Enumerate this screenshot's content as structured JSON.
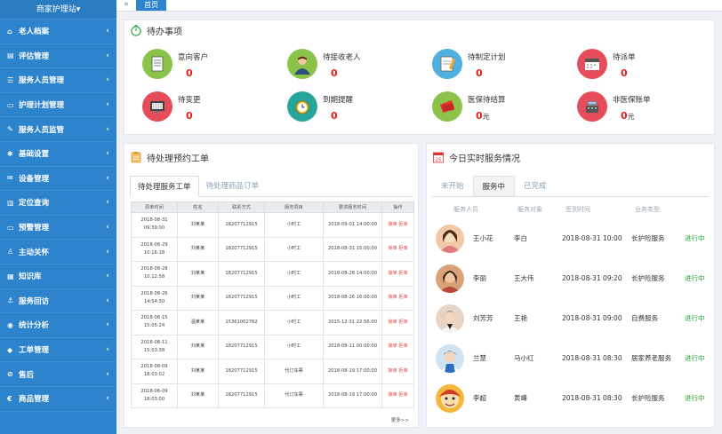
{
  "sidebar": {
    "brand": "商家护理站",
    "items": [
      {
        "icon": "home-icon",
        "glyph": "⌂",
        "label": "老人档案"
      },
      {
        "icon": "clipboard-icon",
        "glyph": "▤",
        "label": "评估管理"
      },
      {
        "icon": "list-icon",
        "glyph": "☰",
        "label": "服务人员管理"
      },
      {
        "icon": "folder-icon",
        "glyph": "▭",
        "label": "护理计划管理"
      },
      {
        "icon": "pencil-icon",
        "glyph": "✎",
        "label": "服务人员监管"
      },
      {
        "icon": "gear-icon",
        "glyph": "✱",
        "label": "基础设置"
      },
      {
        "icon": "envelope-icon",
        "glyph": "✉",
        "label": "设备管理"
      },
      {
        "icon": "building-icon",
        "glyph": "▥",
        "label": "定位查询"
      },
      {
        "icon": "monitor-icon",
        "glyph": "▭",
        "label": "预警管理"
      },
      {
        "icon": "user-icon",
        "glyph": "♙",
        "label": "主动关怀"
      },
      {
        "icon": "grid-icon",
        "glyph": "▦",
        "label": "知识库"
      },
      {
        "icon": "anchor-icon",
        "glyph": "⚓",
        "label": "服务回访"
      },
      {
        "icon": "chart-icon",
        "glyph": "◉",
        "label": "统计分析"
      },
      {
        "icon": "tag-icon",
        "glyph": "◆",
        "label": "工单管理"
      },
      {
        "icon": "cancel-icon",
        "glyph": "⊘",
        "label": "售后"
      },
      {
        "icon": "euro-icon",
        "glyph": "€",
        "label": "商品管理"
      }
    ]
  },
  "topbar": {
    "home_tab": "首页"
  },
  "todo": {
    "title": "待办事项",
    "items": [
      {
        "label": "意向客户",
        "value": "0",
        "unit": "",
        "color": "#8bc34a",
        "icon": "document-icon"
      },
      {
        "label": "待接收老人",
        "value": "0",
        "unit": "",
        "color": "#8bc34a",
        "icon": "person-icon"
      },
      {
        "label": "待制定计划",
        "value": "0",
        "unit": "",
        "color": "#4fb0e0",
        "icon": "notepad-icon"
      },
      {
        "label": "待派单",
        "value": "0",
        "unit": "",
        "color": "#e54d5a",
        "icon": "calendar-icon"
      },
      {
        "label": "待变更",
        "value": "0",
        "unit": "",
        "color": "#e54d5a",
        "icon": "monitor-icon"
      },
      {
        "label": "到期提醒",
        "value": "0",
        "unit": "",
        "color": "#26a69a",
        "icon": "clock-icon"
      },
      {
        "label": "医保待结算",
        "value": "0",
        "unit": "元",
        "color": "#8bc34a",
        "icon": "money-icon"
      },
      {
        "label": "非医保账单",
        "value": "0",
        "unit": "元",
        "color": "#e54d5a",
        "icon": "cash-register-icon"
      }
    ]
  },
  "orders": {
    "title": "待处理预约工单",
    "tabs": [
      "待处理服务工单",
      "待处理商品订单"
    ],
    "columns": [
      "原单时间",
      "姓名",
      "联系方式",
      "服务项目",
      "要求服务时间",
      "操作"
    ],
    "rows": [
      {
        "time": "2018-08-31 09:39:00",
        "name": "刘某某",
        "phone": "18207712915",
        "item": "小时工",
        "service_time": "2018-09-01 14:00:00",
        "op": "接单 拒单"
      },
      {
        "time": "2018-08-29 10:16:18",
        "name": "刘某某",
        "phone": "18207712915",
        "item": "小时工",
        "service_time": "2018-08-31 15:00:00",
        "op": "接单 拒单"
      },
      {
        "time": "2018-08-28 10:12:58",
        "name": "刘某某",
        "phone": "18207712915",
        "item": "小时工",
        "service_time": "2018-08-28 14:00:00",
        "op": "接单 拒单"
      },
      {
        "time": "2018-08-26 14:54:30",
        "name": "刘某某",
        "phone": "18207712915",
        "item": "小时工",
        "service_time": "2018-08-26 16:00:00",
        "op": "接单 拒单"
      },
      {
        "time": "2018-08-15 15:05:24",
        "name": "温某某",
        "phone": "15361002762",
        "item": "小时工",
        "service_time": "2015-12-31 22:56:00",
        "op": "接单 拒单"
      },
      {
        "time": "2018-08-11 15:03:38",
        "name": "刘某某",
        "phone": "18207712915",
        "item": "小时工",
        "service_time": "2018-08-11 00:00:00",
        "op": "接单 拒单"
      },
      {
        "time": "2018-08-09 18:03:02",
        "name": "刘某某",
        "phone": "18207712915",
        "item": "代订车票",
        "service_time": "2018-08-19 17:00:00",
        "op": "接单 拒单"
      },
      {
        "time": "2018-08-09 18:03:00",
        "name": "刘某某",
        "phone": "18207712915",
        "item": "代订车票",
        "service_time": "2018-08-19 17:00:00",
        "op": "接单 拒单"
      }
    ],
    "more": "更多>>"
  },
  "today": {
    "title": "今日实时服务情况",
    "calendar_day": "25",
    "tabs": [
      "未开始",
      "服务中",
      "已完成"
    ],
    "columns": [
      "服务人员",
      "服务对象",
      "签到时间",
      "业务类型"
    ],
    "rows": [
      {
        "staff": "王小花",
        "client": "李白",
        "checkin": "2018-08-31 10:00",
        "type": "长护险服务",
        "status": "进行中",
        "avatar": "#f2c9a8"
      },
      {
        "staff": "李丽",
        "client": "王大伟",
        "checkin": "2018-08-31 09:20",
        "type": "长护险服务",
        "status": "进行中",
        "avatar": "#d9a27a"
      },
      {
        "staff": "刘芳芳",
        "client": "王艳",
        "checkin": "2018-08-31 09:00",
        "type": "自费服务",
        "status": "进行中",
        "avatar": "#e8d4c4"
      },
      {
        "staff": "兰慧",
        "client": "马小红",
        "checkin": "2018-08-31 08:30",
        "type": "居家养老服务",
        "status": "进行中",
        "avatar": "#cfe3f2"
      },
      {
        "staff": "李超",
        "client": "黄峰",
        "checkin": "2018-08-31 08:30",
        "type": "长护险服务",
        "status": "进行中",
        "avatar": "#f5b63c"
      }
    ]
  }
}
